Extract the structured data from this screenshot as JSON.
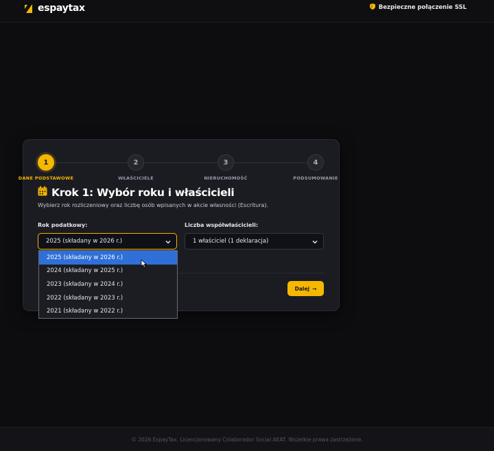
{
  "header": {
    "brand": "espaytax",
    "ssl_text": "Bezpieczne połączenie SSL"
  },
  "stepper": {
    "steps": [
      {
        "number": "1",
        "label": "DANE PODSTAWOWE",
        "state": "active"
      },
      {
        "number": "2",
        "label": "WŁAŚCICIELE",
        "state": "inactive"
      },
      {
        "number": "3",
        "label": "NIERUCHOMOŚĆ",
        "state": "inactive"
      },
      {
        "number": "4",
        "label": "PODSUMOWANIE",
        "state": "inactive"
      }
    ]
  },
  "form": {
    "title": "Krok 1: Wybór roku i właścicieli",
    "subtitle": "Wybierz rok rozliczeniowy oraz liczbę osób wpisanych w akcie własności (Escritura).",
    "year_label": "Rok podatkowy:",
    "year_value": "2025 (składany w 2026 r.)",
    "year_options": [
      "2025 (składany w 2026 r.)",
      "2024 (składany w 2025 r.)",
      "2023 (składany w 2024 r.)",
      "2022 (składany w 2023 r.)",
      "2021 (składany w 2022 r.)"
    ],
    "owners_label": "Liczba współwłaścicieli:",
    "owners_value": "1 właściciel (1 deklaracja)",
    "next_label": "Dalej",
    "next_arrow": "→"
  },
  "footer": {
    "text": "© 2026 EspayTax. Licencjonowany Colaborador Social AEAT. Wszelkie prawa zastrzeżone."
  },
  "colors": {
    "accent": "#f5b800",
    "background": "#0d0d10",
    "card": "#1b1c22",
    "dropdown_highlight": "#2f6fd8"
  },
  "icons": {
    "logo": "espaytax-logo-icon",
    "ssl": "shield-icon",
    "title": "calendar-icon",
    "select": "chevron-down-icon",
    "cursor": "mouse-pointer-icon"
  }
}
